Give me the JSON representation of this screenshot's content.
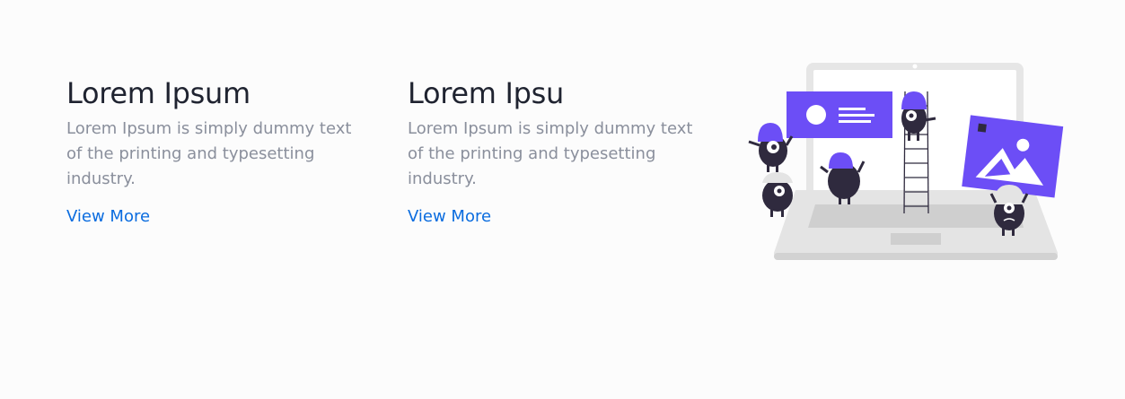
{
  "cards": [
    {
      "title": "Lorem Ipsum",
      "text": "Lorem Ipsum is simply dummy text of the printing and typesetting industry.",
      "link": "View More"
    },
    {
      "title": "Lorem Ipsu",
      "text": "Lorem Ipsum is simply dummy text of the printing and typesetting industry.",
      "link": "View More"
    }
  ],
  "illustration": {
    "icon": "laptop-monsters-illustration",
    "colors": {
      "accent": "#6c4ef6",
      "laptop": "#e4e4e4",
      "laptop_dark": "#cfcfcf",
      "monster": "#2f2a3e",
      "text_heading": "#1f2330",
      "text_body": "#8a8f9c",
      "link": "#0a6cdf"
    }
  }
}
